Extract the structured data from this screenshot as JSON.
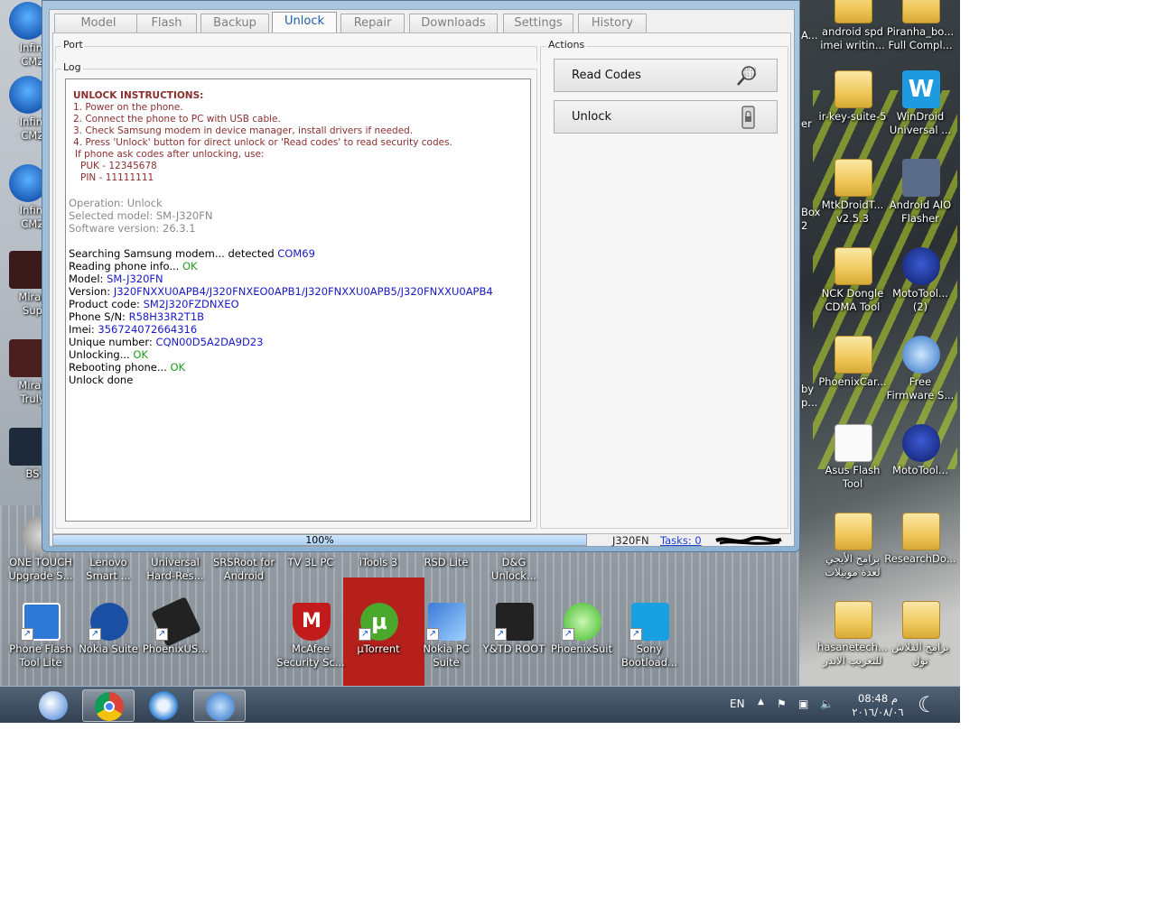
{
  "window": {
    "tabs": [
      "Model",
      "Flash",
      "Backup",
      "Unlock",
      "Repair",
      "Downloads",
      "Settings",
      "History"
    ],
    "active_tab": "Unlock"
  },
  "port_group_title": "Port",
  "log_group_title": "Log",
  "actions_group_title": "Actions",
  "actions": {
    "read_codes_label": "Read Codes",
    "unlock_label": "Unlock"
  },
  "log": {
    "instructions": {
      "heading": "UNLOCK INSTRUCTIONS:",
      "steps": [
        "1. Power on the phone.",
        "2. Connect the phone to PC with USB cable.",
        "3. Check Samsung modem in device manager, install drivers if needed.",
        "4. Press 'Unlock' button for direct unlock or 'Read codes' to read security codes."
      ],
      "note": "If phone ask codes after unlocking, use:",
      "puk": "PUK - 12345678",
      "pin": "PIN - 11111111"
    },
    "operation": "Operation: Unlock",
    "selected_model": "Selected model: SM-J320FN",
    "software_version": "Software version: 26.3.1",
    "lines": [
      {
        "label": "Searching Samsung modem... detected ",
        "value": "COM69",
        "color": "blue"
      },
      {
        "label": "Reading phone info... ",
        "value": "OK",
        "color": "green"
      },
      {
        "label": "Model: ",
        "value": "SM-J320FN",
        "color": "blue"
      },
      {
        "label": "Version: ",
        "value": "J320FNXXU0APB4/J320FNXEO0APB1/J320FNXXU0APB5/J320FNXXU0APB4",
        "color": "blue"
      },
      {
        "label": "Product code: ",
        "value": "SM2J320FZDNXEO",
        "color": "blue"
      },
      {
        "label": "Phone S/N: ",
        "value": "R58H33R2T1B",
        "color": "blue"
      },
      {
        "label": "Imei: ",
        "value": "356724072664316",
        "color": "blue"
      },
      {
        "label": "Unique number: ",
        "value": "CQN00D5A2DA9D23",
        "color": "blue"
      },
      {
        "label": "Unlocking... ",
        "value": "OK",
        "color": "green"
      },
      {
        "label": "Rebooting phone... ",
        "value": "OK",
        "color": "green"
      },
      {
        "label": "Unlock done",
        "value": "",
        "color": "black"
      }
    ]
  },
  "status": {
    "progress_percent": 100,
    "progress_text": "100%",
    "model": "J320FN",
    "tasks": "Tasks: 0"
  },
  "desktop_icons": [
    {
      "label": "Infini\nCM2",
      "kind": "appblue"
    },
    {
      "label": "Infini\nCM2",
      "kind": "appblue"
    },
    {
      "label": "Infini\nCM2",
      "kind": "appblue"
    },
    {
      "label": "Mirac\nSup",
      "kind": "dark"
    },
    {
      "label": "Mirac\nTruly",
      "kind": "dark"
    },
    {
      "label": "BS",
      "kind": "dark"
    },
    {
      "label": "ONE TOUCH\nUpgrade S...",
      "kind": "gear"
    },
    {
      "label": "Lenovo\nSmart ...",
      "kind": "none"
    },
    {
      "label": "Universal\nHard-Res...",
      "kind": "none"
    },
    {
      "label": "SRSRoot for\nAndroid",
      "kind": "none"
    },
    {
      "label": "TV 3L PC",
      "kind": "none"
    },
    {
      "label": "iTools 3",
      "kind": "none"
    },
    {
      "label": "RSD Lite",
      "kind": "none"
    },
    {
      "label": "D&G\nUnlock...",
      "kind": "none"
    },
    {
      "label": "Phone Flash\nTool Lite",
      "kind": "intel"
    },
    {
      "label": "Nokia Suite",
      "kind": "nokia"
    },
    {
      "label": "PhoenixUS...",
      "kind": "chip"
    },
    {
      "label": "McAfee\nSecurity Sc...",
      "kind": "mcafee"
    },
    {
      "label": "µTorrent",
      "kind": "utorrent"
    },
    {
      "label": "Nokia PC\nSuite",
      "kind": "nokiapc"
    },
    {
      "label": "Y&TD ROOT",
      "kind": "android"
    },
    {
      "label": "PhoenixSuit",
      "kind": "phoenix"
    },
    {
      "label": "Sony\nBootload...",
      "kind": "sony"
    },
    {
      "label": "android spd\nimei writin...",
      "kind": "folder"
    },
    {
      "label": "Piranha_bo...\nFull Compl...",
      "kind": "folder"
    },
    {
      "label": "ir-key-suite-5",
      "kind": "folder"
    },
    {
      "label": "WinDroid\nUniversal ...",
      "kind": "word"
    },
    {
      "label": "MtkDroidT...\nv2.5.3",
      "kind": "folder"
    },
    {
      "label": "Android AIO\nFlasher",
      "kind": "laptop"
    },
    {
      "label": "NCK Dongle\nCDMA Tool",
      "kind": "folder"
    },
    {
      "label": "MotoTool...\n(2)",
      "kind": "moto"
    },
    {
      "label": "PhoenixCar...",
      "kind": "folder"
    },
    {
      "label": "Free\nFirmware S...",
      "kind": "globe"
    },
    {
      "label": "Asus Flash\nTool",
      "kind": "doc"
    },
    {
      "label": "MotoTool...",
      "kind": "moto"
    },
    {
      "label": "برامج الأيجي\nلعدة موبيلات",
      "kind": "folder"
    },
    {
      "label": "ResearchDo...",
      "kind": "folder"
    },
    {
      "label": "hasanetech...\nللتعريب الاندر",
      "kind": "folder"
    },
    {
      "label": "برامج الفلاش\nتول",
      "kind": "folder"
    },
    {
      "label": "A...",
      "kind": "partial"
    },
    {
      "label": "er",
      "kind": "partial"
    },
    {
      "label": "Box\n2",
      "kind": "partial"
    },
    {
      "label": "by\np...",
      "kind": "partial"
    }
  ],
  "taskbar": {
    "language": "EN",
    "time": "08:48 م",
    "date": "٢٠١٦/٠٨/٠٦"
  }
}
